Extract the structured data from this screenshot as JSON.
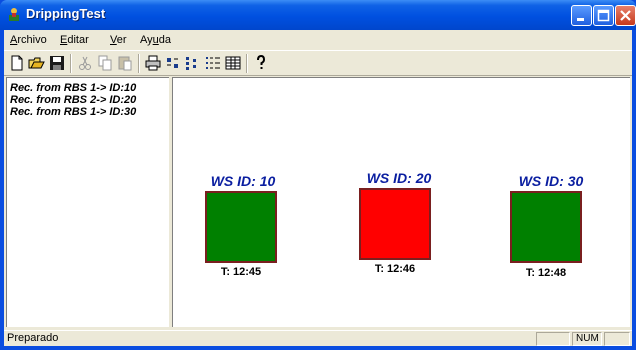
{
  "window": {
    "title": "DrippingTest",
    "icon": "app-icon"
  },
  "menu": {
    "items": [
      {
        "accel": "A",
        "rest": "rchivo"
      },
      {
        "accel": "E",
        "rest": "ditar"
      },
      {
        "accel": "V",
        "rest": "er"
      },
      {
        "accel": "",
        "rest": "Ayuda",
        "accel_after": "u"
      }
    ],
    "archivo_accel": "A",
    "archivo_rest": "rchivo",
    "editar_accel": "E",
    "editar_rest": "ditar",
    "ver_accel": "V",
    "ver_rest": "er",
    "ayuda_pre": "Ay",
    "ayuda_accel": "u",
    "ayuda_post": "da"
  },
  "toolbar": {
    "icons": [
      "new-icon",
      "open-icon",
      "save-icon",
      "cut-icon",
      "copy-icon",
      "paste-icon",
      "print-icon",
      "large-icons-icon",
      "small-icons-icon",
      "list-icon",
      "details-icon",
      "help-icon"
    ]
  },
  "log": {
    "lines": [
      "Rec. from RBS 1-> ID:10",
      "Rec. from RBS 2-> ID:20",
      "Rec. from RBS 1-> ID:30"
    ]
  },
  "stations": [
    {
      "label": "WS ID: 10",
      "time": "T: 12:45",
      "color": "#008000"
    },
    {
      "label": "WS ID: 20",
      "time": "T: 12:46",
      "color": "#ff0000"
    },
    {
      "label": "WS ID: 30",
      "time": "T: 12:48",
      "color": "#008000"
    }
  ],
  "status": {
    "text": "Preparado",
    "num": "NUM"
  }
}
